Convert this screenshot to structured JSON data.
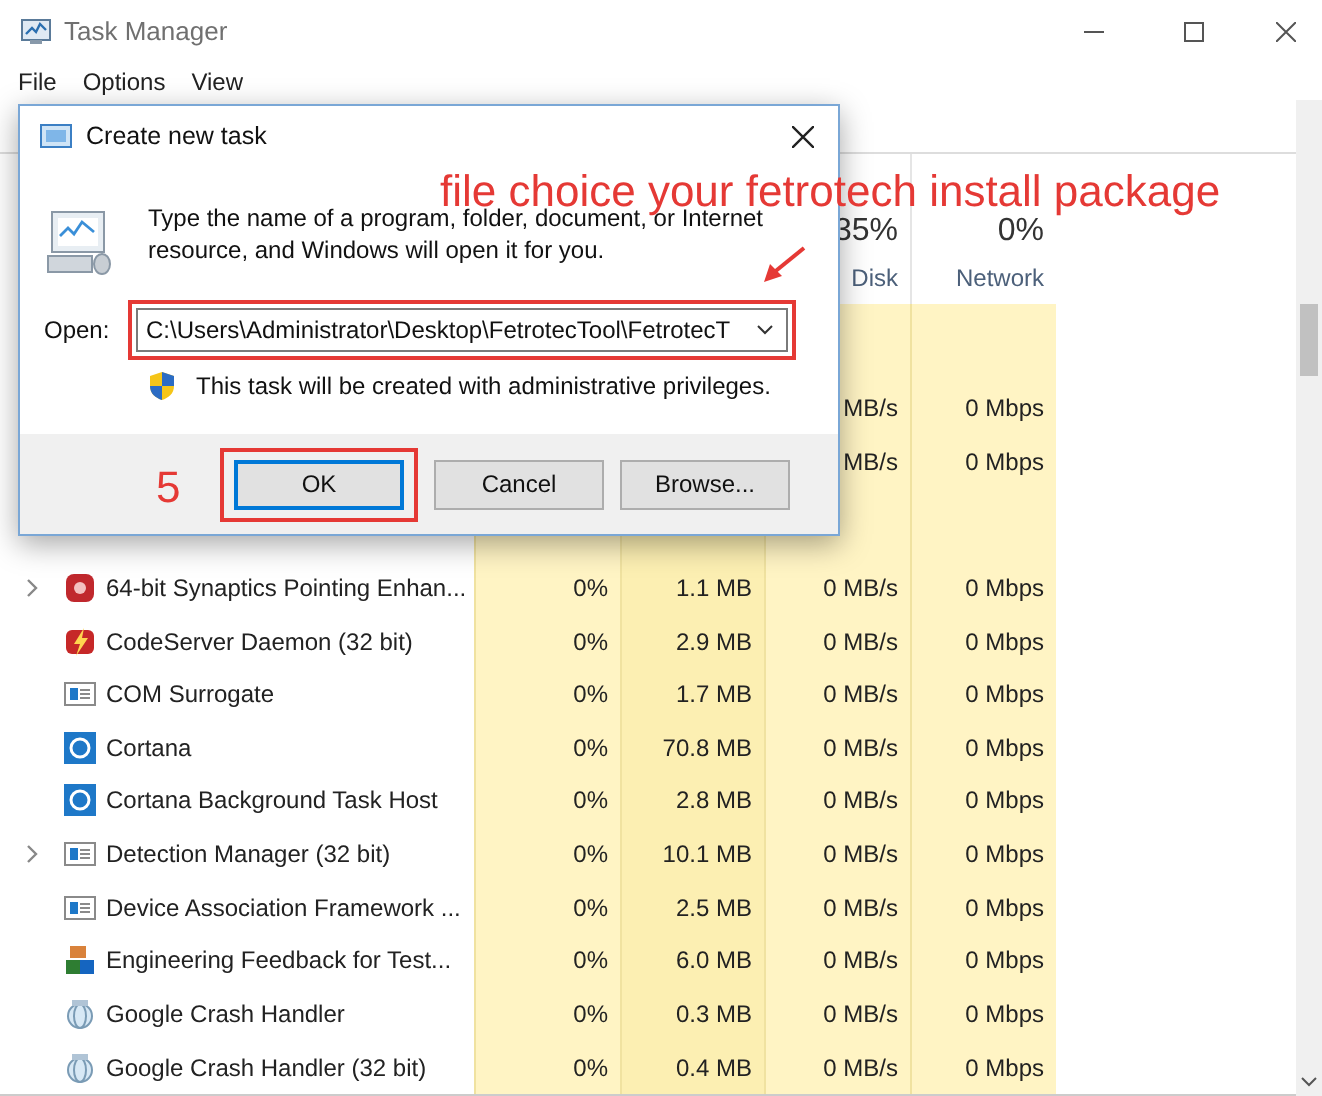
{
  "window": {
    "title": "Task Manager"
  },
  "menu": [
    "File",
    "Options",
    "View"
  ],
  "table": {
    "header": [
      {
        "percent": "35%",
        "label": "Disk"
      },
      {
        "percent": "0%",
        "label": "Network"
      }
    ],
    "covered_rows": [
      {
        "disk": "MB/s",
        "network": "0 Mbps"
      },
      {
        "disk": "MB/s",
        "network": "0 Mbps"
      }
    ],
    "rows": [
      {
        "kind": "synaptics",
        "expandable": true,
        "name": "64-bit Synaptics Pointing Enhan...",
        "cpu": "0%",
        "memory": "1.1 MB",
        "disk": "0 MB/s",
        "network": "0 Mbps"
      },
      {
        "kind": "lightning",
        "expandable": false,
        "name": "CodeServer Daemon (32 bit)",
        "cpu": "0%",
        "memory": "2.9 MB",
        "disk": "0 MB/s",
        "network": "0 Mbps"
      },
      {
        "kind": "window",
        "expandable": false,
        "name": "COM Surrogate",
        "cpu": "0%",
        "memory": "1.7 MB",
        "disk": "0 MB/s",
        "network": "0 Mbps"
      },
      {
        "kind": "ring",
        "expandable": false,
        "name": "Cortana",
        "cpu": "0%",
        "memory": "70.8 MB",
        "disk": "0 MB/s",
        "network": "0 Mbps"
      },
      {
        "kind": "ring",
        "expandable": false,
        "name": "Cortana Background Task Host",
        "cpu": "0%",
        "memory": "2.8 MB",
        "disk": "0 MB/s",
        "network": "0 Mbps"
      },
      {
        "kind": "window",
        "expandable": true,
        "name": "Detection Manager (32 bit)",
        "cpu": "0%",
        "memory": "10.1 MB",
        "disk": "0 MB/s",
        "network": "0 Mbps"
      },
      {
        "kind": "window",
        "expandable": false,
        "name": "Device Association Framework ...",
        "cpu": "0%",
        "memory": "2.5 MB",
        "disk": "0 MB/s",
        "network": "0 Mbps"
      },
      {
        "kind": "blocks",
        "expandable": false,
        "name": "Engineering Feedback for Test...",
        "cpu": "0%",
        "memory": "6.0 MB",
        "disk": "0 MB/s",
        "network": "0 Mbps"
      },
      {
        "kind": "globe",
        "expandable": false,
        "name": "Google Crash Handler",
        "cpu": "0%",
        "memory": "0.3 MB",
        "disk": "0 MB/s",
        "network": "0 Mbps"
      },
      {
        "kind": "globe",
        "expandable": false,
        "name": "Google Crash Handler (32 bit)",
        "cpu": "0%",
        "memory": "0.4 MB",
        "disk": "0 MB/s",
        "network": "0 Mbps"
      }
    ]
  },
  "dialog": {
    "title": "Create new task",
    "message": "Type the name of a program, folder, document, or Internet resource, and Windows will open it for you.",
    "open_label": "Open:",
    "open_value": "C:\\Users\\Administrator\\Desktop\\FetrotecTool\\FetrotecT",
    "note": "This task will be created with administrative privileges.",
    "buttons": [
      {
        "label": "OK",
        "focused": true
      },
      {
        "label": "Cancel",
        "focused": false
      },
      {
        "label": "Browse...",
        "focused": false
      }
    ]
  },
  "annotations": [
    {
      "kind": "caption",
      "text": "file choice your fetrotech install package"
    },
    {
      "kind": "step",
      "text": "5"
    }
  ]
}
